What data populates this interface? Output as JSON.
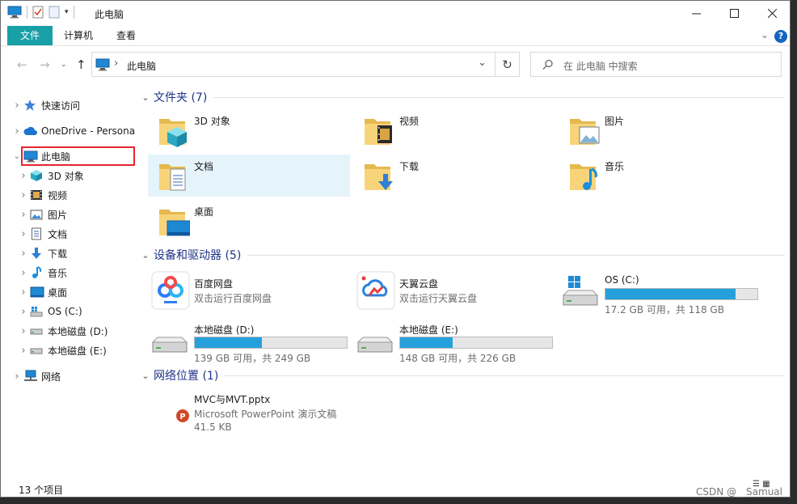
{
  "window": {
    "title": "此电脑"
  },
  "ribbon": {
    "tabs": [
      "文件",
      "计算机",
      "查看"
    ],
    "help_label": "?"
  },
  "address": {
    "crumb_separator": "›",
    "location": "此电脑",
    "search_placeholder": "在 此电脑 中搜索"
  },
  "nav": {
    "items": [
      {
        "label": "快速访问",
        "icon": "star-icon",
        "level": 0
      },
      {
        "label": "OneDrive - Persona",
        "icon": "cloud-icon",
        "level": 0
      },
      {
        "label": "此电脑",
        "icon": "computer-icon",
        "level": 0,
        "expanded": true,
        "selected": true
      },
      {
        "label": "3D 对象",
        "icon": "cube-icon",
        "level": 1
      },
      {
        "label": "视频",
        "icon": "film-icon",
        "level": 1
      },
      {
        "label": "图片",
        "icon": "picture-icon",
        "level": 1
      },
      {
        "label": "文档",
        "icon": "document-icon",
        "level": 1
      },
      {
        "label": "下载",
        "icon": "download-arrow-icon",
        "level": 1
      },
      {
        "label": "音乐",
        "icon": "music-note-icon",
        "level": 1
      },
      {
        "label": "桌面",
        "icon": "desktop-icon",
        "level": 1
      },
      {
        "label": "OS (C:)",
        "icon": "windows-drive-icon",
        "level": 1
      },
      {
        "label": "本地磁盘 (D:)",
        "icon": "drive-icon",
        "level": 1
      },
      {
        "label": "本地磁盘 (E:)",
        "icon": "drive-icon",
        "level": 1
      },
      {
        "label": "网络",
        "icon": "network-icon",
        "level": 0
      }
    ]
  },
  "groups": {
    "folders": {
      "title": "文件夹 (7)",
      "items": [
        {
          "label": "3D 对象",
          "icon": "cube-folder-icon"
        },
        {
          "label": "视频",
          "icon": "video-folder-icon"
        },
        {
          "label": "图片",
          "icon": "pictures-folder-icon"
        },
        {
          "label": "文档",
          "icon": "documents-folder-icon"
        },
        {
          "label": "下载",
          "icon": "downloads-folder-icon"
        },
        {
          "label": "音乐",
          "icon": "music-folder-icon"
        },
        {
          "label": "桌面",
          "icon": "desktop-folder-icon"
        }
      ]
    },
    "devices": {
      "title": "设备和驱动器 (5)",
      "apps": [
        {
          "name": "百度网盘",
          "sub": "双击运行百度网盘",
          "icon": "baidu-netdisk-icon"
        },
        {
          "name": "天翼云盘",
          "sub": "双击运行天翼云盘",
          "icon": "tianyi-cloud-icon"
        }
      ],
      "drives": [
        {
          "name": "OS (C:)",
          "free": "17.2 GB 可用，共 118 GB",
          "used_fraction": 0.854,
          "icon": "windows-drive-icon"
        },
        {
          "name": "本地磁盘 (D:)",
          "free": "139 GB 可用，共 249 GB",
          "used_fraction": 0.44,
          "icon": "drive-icon"
        },
        {
          "name": "本地磁盘 (E:)",
          "free": "148 GB 可用，共 226 GB",
          "used_fraction": 0.345,
          "icon": "drive-icon"
        }
      ]
    },
    "network": {
      "title": "网络位置 (1)",
      "items": [
        {
          "name": "MVC与MVT.pptx",
          "type": "Microsoft PowerPoint 演示文稿",
          "size": "41.5 KB",
          "icon": "powerpoint-icon"
        }
      ]
    }
  },
  "status": {
    "count": "13 个项目"
  },
  "watermark": "CSDN @__Samual",
  "colors": {
    "accent": "#19a0a7",
    "selection": "#e5f3fb",
    "drive_bar": "#26a0da",
    "group_title": "#1e3287",
    "highlight_box": "#e4262f"
  }
}
